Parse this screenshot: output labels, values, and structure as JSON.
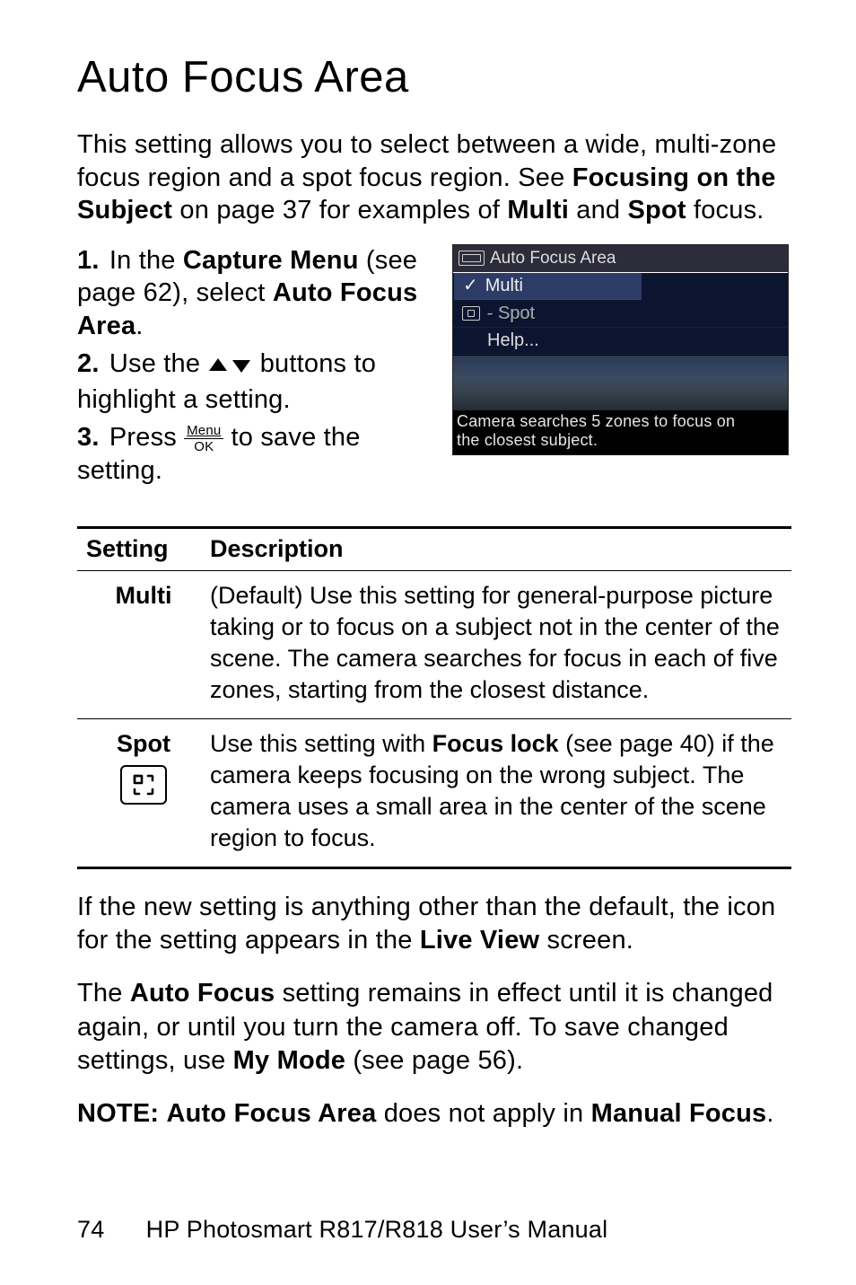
{
  "title": "Auto Focus Area",
  "intro_parts": {
    "p1": "This setting allows you to select between a wide, multi-zone focus region and a spot focus region. See ",
    "b1": "Focusing on the Subject",
    "p2": " on page 37 for examples of ",
    "b2": "Multi",
    "p3": " and ",
    "b3": "Spot",
    "p4": " focus."
  },
  "steps": [
    {
      "num": "1.",
      "pre": "In the ",
      "b1": "Capture Menu",
      "mid": " (see page 62), select ",
      "b2": "Auto Focus Area",
      "post": "."
    },
    {
      "num": "2.",
      "pre": "Use the ",
      "post": " buttons to highlight a setting."
    },
    {
      "num": "3.",
      "pre": "Press ",
      "post": " to save the setting."
    }
  ],
  "menuok": {
    "top": "Menu",
    "bot": "OK"
  },
  "cam": {
    "title": "Auto Focus Area",
    "items": {
      "multi": "Multi",
      "spot": "- Spot",
      "help": "Help..."
    },
    "check": "✓",
    "caption1": "Camera searches 5 zones to focus on",
    "caption2": "the closest subject."
  },
  "table": {
    "h1": "Setting",
    "h2": "Description",
    "rows": [
      {
        "name": "Multi",
        "desc": "(Default) Use this setting for general-purpose picture taking or to focus on a subject not in the center of the scene. The camera searches for focus in each of five zones, starting from the closest distance."
      },
      {
        "name": "Spot",
        "desc_pre": "Use this setting with ",
        "desc_b": "Focus lock",
        "desc_post": " (see page 40) if the camera keeps focusing on the wrong subject. The camera uses a small area in the center of the scene region to focus."
      }
    ]
  },
  "para1": {
    "p1": "If the new setting is anything other than the default, the icon for the setting appears in the ",
    "b1": "Live View",
    "p2": " screen."
  },
  "para2": {
    "p1": "The ",
    "b1": "Auto Focus",
    "p2": " setting remains in effect until it is changed again, or until you turn the camera off. To save changed settings, use ",
    "b2": "My Mode",
    "p3": " (see page 56)."
  },
  "note": {
    "b1": "NOTE:",
    "sp": "  ",
    "b2": "Auto Focus Area",
    "p1": " does not apply in ",
    "b3": "Manual Focus",
    "p2": "."
  },
  "footer": {
    "page": "74",
    "title": "HP Photosmart R817/R818 User’s Manual"
  }
}
